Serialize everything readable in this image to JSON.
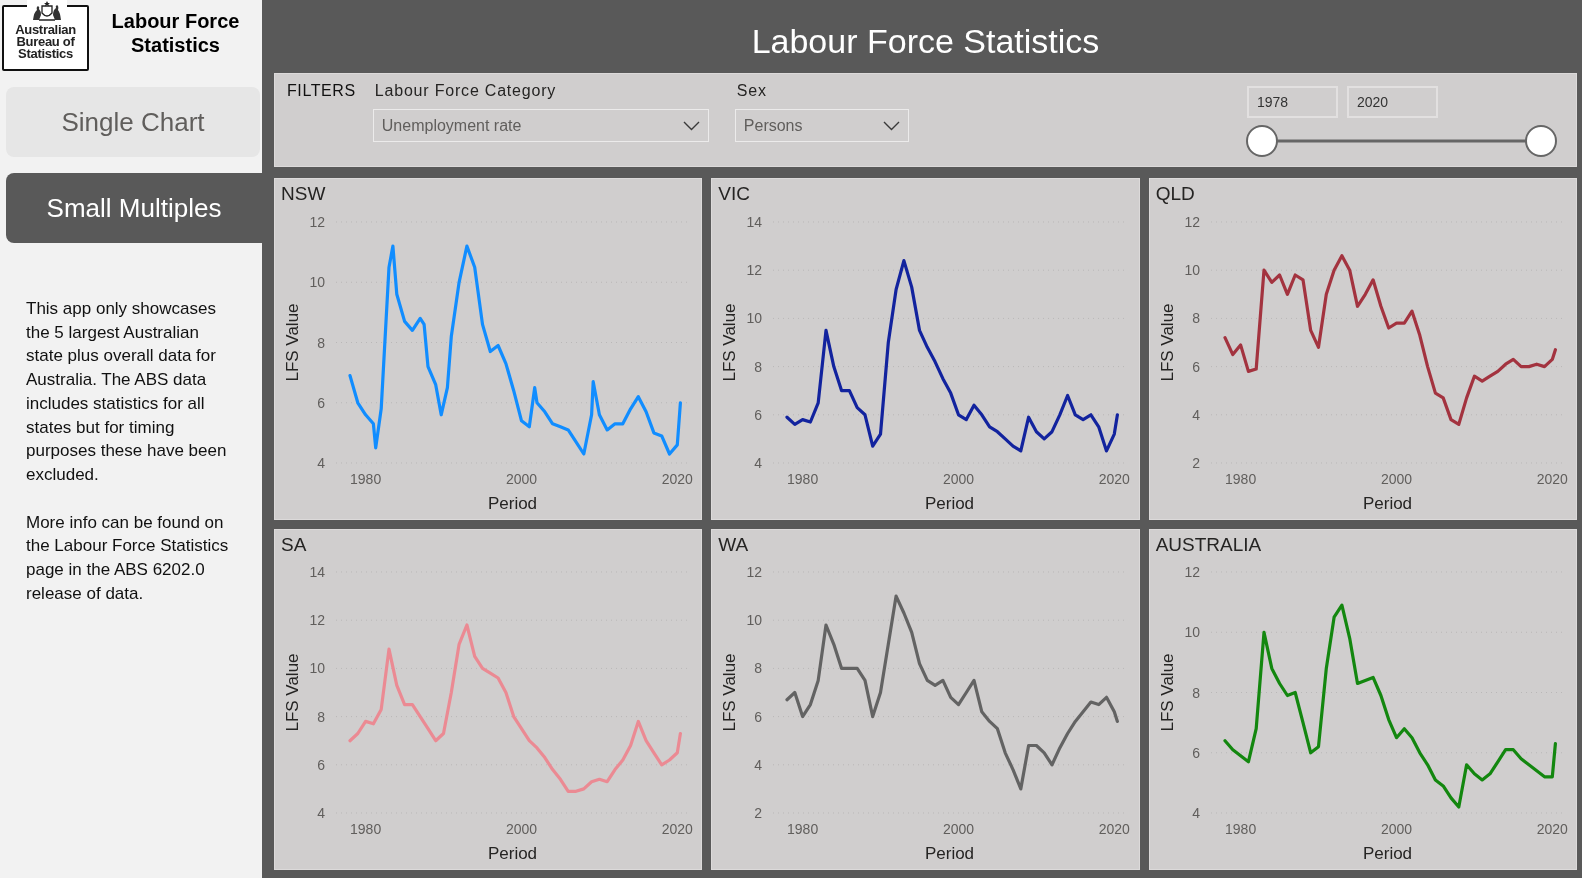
{
  "sidebar": {
    "logo_text": "Australian Bureau of Statistics",
    "title": "Labour Force Statistics",
    "nav": [
      {
        "label": "Single Chart",
        "selected": false
      },
      {
        "label": "Small Multiples",
        "selected": true
      }
    ],
    "notes": [
      "This app only showcases the 5 largest Australian state plus overall data for Australia. The ABS data includes statistics for all states but for timing purposes these have been excluded.",
      "More info can be found on the Labour Force Statistics page in the ABS 6202.0 release of data."
    ]
  },
  "header": {
    "title": "Labour Force Statistics"
  },
  "filters": {
    "label": "FILTERS",
    "dropdowns": [
      {
        "label": "Labour Force Category",
        "value": "Unemployment rate"
      },
      {
        "label": "Sex",
        "value": "Persons"
      }
    ],
    "period": {
      "from": "1978",
      "to": "2020",
      "thumbs": [
        {
          "level": 0
        },
        {
          "level": 1
        }
      ]
    }
  },
  "panels": [
    {
      "chart_data": [
        {
          "type": "line",
          "title": "NSW",
          "xlabel": "Period",
          "ylabel": "LFS Value",
          "x": [
            1978,
            1979,
            1980,
            1981,
            1981.3,
            1982,
            1983,
            1983.5,
            1984,
            1985,
            1986,
            1987,
            1987.5,
            1988,
            1989,
            1989.7,
            1990.5,
            1991,
            1992,
            1993,
            1994,
            1995,
            1996,
            1997,
            1998,
            1999,
            2000,
            2001,
            2001.7,
            2002,
            2003,
            2004,
            2005,
            2006,
            2007,
            2008,
            2009,
            2009.2,
            2010,
            2011,
            2012,
            2013,
            2014,
            2015,
            2016,
            2017,
            2018,
            2019,
            2020,
            2020.4
          ],
          "values": [
            6.9,
            6.0,
            5.6,
            5.3,
            4.5,
            5.8,
            10.5,
            11.2,
            9.6,
            8.7,
            8.4,
            8.8,
            8.6,
            7.2,
            6.6,
            5.6,
            6.5,
            8.2,
            10.0,
            11.2,
            10.5,
            8.6,
            7.7,
            7.9,
            7.3,
            6.4,
            5.4,
            5.2,
            6.5,
            6.0,
            5.7,
            5.3,
            5.2,
            5.1,
            4.7,
            4.3,
            5.6,
            6.7,
            5.6,
            5.1,
            5.3,
            5.3,
            5.8,
            6.2,
            5.7,
            5.0,
            4.9,
            4.3,
            4.6,
            6.0
          ],
          "color": "#118dff",
          "xlim": [
            1976.2,
            2021.5
          ],
          "ylim": [
            4,
            12
          ],
          "xticks": [
            1980,
            2000,
            2020
          ],
          "yticks": [
            4,
            6,
            8,
            10,
            12
          ],
          "grid": true
        }
      ]
    },
    {
      "chart_data": [
        {
          "type": "line",
          "title": "VIC",
          "xlabel": "Period",
          "ylabel": "LFS Value",
          "x": [
            1978,
            1979,
            1980,
            1981,
            1982,
            1983,
            1984,
            1985,
            1986,
            1987,
            1988,
            1989,
            1990,
            1991,
            1992,
            1993,
            1994,
            1995,
            1996,
            1997,
            1998,
            1999,
            2000,
            2001,
            2002,
            2003,
            2004,
            2005,
            2006,
            2007,
            2008,
            2009,
            2010,
            2011,
            2012,
            2013,
            2014,
            2015,
            2016,
            2017,
            2018,
            2019,
            2020,
            2020.4
          ],
          "values": [
            5.9,
            5.6,
            5.8,
            5.7,
            6.5,
            9.5,
            8.0,
            7.0,
            7.0,
            6.3,
            6.0,
            4.7,
            5.2,
            9.0,
            11.2,
            12.4,
            11.3,
            9.5,
            8.8,
            8.2,
            7.5,
            6.9,
            6.0,
            5.8,
            6.4,
            6.0,
            5.5,
            5.3,
            5.0,
            4.7,
            4.5,
            5.9,
            5.3,
            5.0,
            5.3,
            6.0,
            6.8,
            6.0,
            5.8,
            6.0,
            5.5,
            4.5,
            5.2,
            6.0
          ],
          "color": "#12239e",
          "xlim": [
            1976.2,
            2021.5
          ],
          "ylim": [
            4,
            14
          ],
          "xticks": [
            1980,
            2000,
            2020
          ],
          "yticks": [
            4,
            6,
            8,
            10,
            12,
            14
          ],
          "grid": true
        }
      ]
    },
    {
      "chart_data": [
        {
          "type": "line",
          "title": "QLD",
          "xlabel": "Period",
          "ylabel": "LFS Value",
          "x": [
            1978,
            1979,
            1980,
            1981,
            1982,
            1983,
            1984,
            1985,
            1986,
            1987,
            1988,
            1989,
            1990,
            1991,
            1992,
            1993,
            1994,
            1995,
            1996,
            1997,
            1998,
            1999,
            2000,
            2001,
            2002,
            2003,
            2004,
            2005,
            2006,
            2007,
            2008,
            2009,
            2010,
            2011,
            2012,
            2013,
            2014,
            2015,
            2016,
            2017,
            2018,
            2019,
            2020,
            2020.4
          ],
          "values": [
            7.2,
            6.5,
            6.9,
            5.8,
            5.9,
            10.0,
            9.5,
            9.8,
            9.0,
            9.8,
            9.6,
            7.5,
            6.8,
            9.0,
            10.0,
            10.6,
            10.0,
            8.5,
            9.0,
            9.6,
            8.5,
            7.6,
            7.8,
            7.8,
            8.3,
            7.3,
            6.0,
            4.9,
            4.7,
            3.8,
            3.6,
            4.7,
            5.6,
            5.4,
            5.6,
            5.8,
            6.1,
            6.3,
            6.0,
            6.0,
            6.1,
            6.0,
            6.3,
            6.7
          ],
          "color": "#a3333f",
          "xlim": [
            1976.2,
            2021.5
          ],
          "ylim": [
            2,
            12
          ],
          "xticks": [
            1980,
            2000,
            2020
          ],
          "yticks": [
            2,
            4,
            6,
            8,
            10,
            12
          ],
          "grid": true
        }
      ]
    },
    {
      "chart_data": [
        {
          "type": "line",
          "title": "SA",
          "xlabel": "Period",
          "ylabel": "LFS Value",
          "x": [
            1978,
            1979,
            1980,
            1981,
            1982,
            1983,
            1984,
            1985,
            1986,
            1987,
            1988,
            1989,
            1990,
            1991,
            1992,
            1993,
            1994,
            1995,
            1996,
            1997,
            1998,
            1999,
            2000,
            2001,
            2002,
            2003,
            2004,
            2005,
            2006,
            2007,
            2008,
            2009,
            2010,
            2011,
            2012,
            2013,
            2014,
            2015,
            2016,
            2017,
            2018,
            2019,
            2020,
            2020.4
          ],
          "values": [
            7.0,
            7.3,
            7.8,
            7.7,
            8.3,
            10.8,
            9.3,
            8.5,
            8.5,
            8.0,
            7.5,
            7.0,
            7.3,
            9.0,
            11.0,
            11.8,
            10.5,
            10.0,
            9.8,
            9.6,
            9.0,
            8.0,
            7.5,
            7.0,
            6.7,
            6.3,
            5.8,
            5.4,
            4.9,
            4.9,
            5.0,
            5.3,
            5.4,
            5.3,
            5.8,
            6.2,
            6.8,
            7.8,
            7.0,
            6.5,
            6.0,
            6.2,
            6.5,
            7.3
          ],
          "color": "#eb8a93",
          "xlim": [
            1976.2,
            2021.5
          ],
          "ylim": [
            4,
            14
          ],
          "xticks": [
            1980,
            2000,
            2020
          ],
          "yticks": [
            4,
            6,
            8,
            10,
            12,
            14
          ],
          "grid": true
        }
      ]
    },
    {
      "chart_data": [
        {
          "type": "line",
          "title": "WA",
          "xlabel": "Period",
          "ylabel": "LFS Value",
          "x": [
            1978,
            1979,
            1980,
            1981,
            1982,
            1983,
            1984,
            1985,
            1986,
            1987,
            1988,
            1989,
            1990,
            1991,
            1992,
            1993,
            1994,
            1995,
            1996,
            1997,
            1998,
            1999,
            2000,
            2001,
            2002,
            2003,
            2004,
            2005,
            2006,
            2007,
            2008,
            2009,
            2010,
            2011,
            2012,
            2013,
            2014,
            2015,
            2016,
            2017,
            2018,
            2019,
            2020,
            2020.4
          ],
          "values": [
            6.7,
            7.0,
            6.0,
            6.5,
            7.5,
            9.8,
            9.0,
            8.0,
            8.0,
            8.0,
            7.5,
            6.0,
            7.0,
            9.0,
            11.0,
            10.3,
            9.5,
            8.2,
            7.5,
            7.3,
            7.5,
            6.8,
            6.5,
            7.0,
            7.5,
            6.2,
            5.8,
            5.5,
            4.5,
            3.8,
            3.0,
            4.8,
            4.8,
            4.5,
            4.0,
            4.7,
            5.3,
            5.8,
            6.2,
            6.6,
            6.5,
            6.8,
            6.2,
            5.8
          ],
          "color": "#636363",
          "xlim": [
            1976.2,
            2021.5
          ],
          "ylim": [
            2,
            12
          ],
          "xticks": [
            1980,
            2000,
            2020
          ],
          "yticks": [
            2,
            4,
            6,
            8,
            10,
            12
          ],
          "grid": true
        }
      ]
    },
    {
      "chart_data": [
        {
          "type": "line",
          "title": "AUSTRALIA",
          "xlabel": "Period",
          "ylabel": "LFS Value",
          "x": [
            1978,
            1979,
            1980,
            1981,
            1982,
            1983,
            1984,
            1985,
            1986,
            1987,
            1988,
            1989,
            1990,
            1991,
            1992,
            1993,
            1994,
            1995,
            1996,
            1997,
            1998,
            1999,
            2000,
            2001,
            2002,
            2003,
            2004,
            2005,
            2006,
            2007,
            2008,
            2009,
            2010,
            2011,
            2012,
            2013,
            2014,
            2015,
            2016,
            2017,
            2018,
            2019,
            2020,
            2020.4
          ],
          "values": [
            6.4,
            6.1,
            5.9,
            5.7,
            6.8,
            10.0,
            8.8,
            8.3,
            7.9,
            8.0,
            7.0,
            6.0,
            6.2,
            8.8,
            10.5,
            10.9,
            9.8,
            8.3,
            8.4,
            8.5,
            7.9,
            7.1,
            6.5,
            6.8,
            6.5,
            6.0,
            5.6,
            5.1,
            4.9,
            4.5,
            4.2,
            5.6,
            5.3,
            5.1,
            5.3,
            5.7,
            6.1,
            6.1,
            5.8,
            5.6,
            5.4,
            5.2,
            5.2,
            6.3
          ],
          "color": "#13870f",
          "xlim": [
            1976.2,
            2021.5
          ],
          "ylim": [
            4,
            12
          ],
          "xticks": [
            1980,
            2000,
            2020
          ],
          "yticks": [
            4,
            6,
            8,
            10,
            12
          ],
          "grid": true
        }
      ]
    }
  ]
}
